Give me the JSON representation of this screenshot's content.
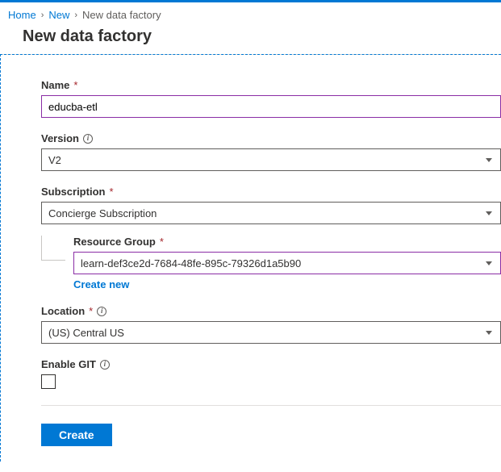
{
  "breadcrumb": {
    "home": "Home",
    "new": "New",
    "current": "New data factory"
  },
  "page": {
    "title": "New data factory"
  },
  "form": {
    "name": {
      "label": "Name",
      "value": "educba-etl"
    },
    "version": {
      "label": "Version",
      "value": "V2"
    },
    "subscription": {
      "label": "Subscription",
      "value": "Concierge Subscription"
    },
    "resourceGroup": {
      "label": "Resource Group",
      "value": "learn-def3ce2d-7684-48fe-895c-79326d1a5b90",
      "createNew": "Create new"
    },
    "location": {
      "label": "Location",
      "value": "(US) Central US"
    },
    "enableGit": {
      "label": "Enable GIT",
      "checked": false
    }
  },
  "actions": {
    "create": "Create"
  }
}
